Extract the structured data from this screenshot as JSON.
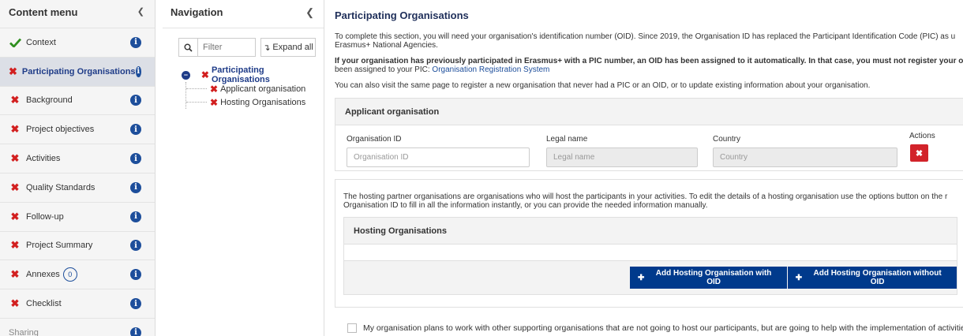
{
  "content_menu": {
    "title": "Content menu",
    "items": [
      {
        "label": "Context",
        "status": "complete"
      },
      {
        "label": "Participating Organisations",
        "status": "incomplete",
        "active": true
      },
      {
        "label": "Background",
        "status": "incomplete"
      },
      {
        "label": "Project objectives",
        "status": "incomplete"
      },
      {
        "label": "Activities",
        "status": "incomplete"
      },
      {
        "label": "Quality Standards",
        "status": "incomplete"
      },
      {
        "label": "Follow-up",
        "status": "incomplete"
      },
      {
        "label": "Project Summary",
        "status": "incomplete"
      },
      {
        "label": "Annexes",
        "status": "incomplete",
        "badge": "0"
      },
      {
        "label": "Checklist",
        "status": "incomplete"
      },
      {
        "label": "Sharing",
        "status": "none"
      }
    ]
  },
  "navigation": {
    "title": "Navigation",
    "filter_placeholder": "Filter",
    "expand_label": "Expand all",
    "tree_root": "Participating Organisations",
    "tree_children": [
      "Applicant organisation",
      "Hosting Organisations"
    ]
  },
  "main": {
    "title": "Participating Organisations",
    "intro_line1": "To complete this section, you will need your organisation's identification number (OID). Since 2019, the Organisation ID has replaced the Participant Identification Code (PIC) as u",
    "intro_line2": "Erasmus+ National Agencies.",
    "bold_line1": "If your organisation has previously participated in Erasmus+ with a PIC number, an OID has been assigned to it automatically. In that case, you must not register your organisat",
    "bold_line2_prefix": "been assigned to your PIC: ",
    "bold_line2_link": "Organisation Registration System",
    "visit_line": "You can also visit the same page to register a new organisation that never had a PIC or an OID, or to update existing information about your organisation.",
    "applicant": {
      "heading": "Applicant organisation",
      "oid_label": "Organisation ID",
      "oid_placeholder": "Organisation ID",
      "legal_label": "Legal name",
      "legal_placeholder": "Legal name",
      "country_label": "Country",
      "country_placeholder": "Country",
      "actions_label": "Actions"
    },
    "hosting": {
      "intro_line1": "The hosting partner organisations are organisations who will host the participants in your activities. To edit the details of a hosting organisation use the options button on the r",
      "intro_line2": "Organisation ID to fill in all the information instantly, or you can provide the needed information manually.",
      "heading": "Hosting Organisations",
      "add_with_oid": "Add Hosting Organisation with OID",
      "add_without_oid": "Add Hosting Organisation without OID"
    },
    "checkbox_label": "My organisation plans to work with other supporting organisations that are not going to host our participants, but are going to help with the implementation of activities."
  },
  "colors": {
    "accent": "#003a8c",
    "error": "#d21f1f",
    "success": "#2f8f1f"
  }
}
